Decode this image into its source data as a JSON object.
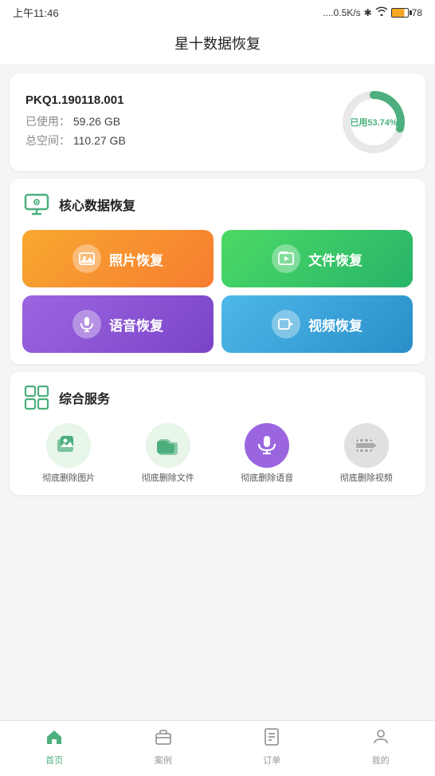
{
  "statusBar": {
    "time": "上午11:46",
    "signal": "....0.5K/s",
    "battery": "78"
  },
  "header": {
    "title": "星十数据恢复"
  },
  "storage": {
    "deviceId": "PKQ1.190118.001",
    "usedLabel": "已使用：",
    "usedValue": "59.26 GB",
    "totalLabel": "总空间：",
    "totalValue": "110.27 GB",
    "usedPercent": "已用53.74%",
    "usedPercentNum": 53.74
  },
  "coreSection": {
    "title": "核心数据恢复",
    "buttons": [
      {
        "id": "photo",
        "label": "照片恢复",
        "icon": "🖼"
      },
      {
        "id": "file",
        "label": "文件恢复",
        "icon": "▶"
      },
      {
        "id": "voice",
        "label": "语音恢复",
        "icon": "🎤"
      },
      {
        "id": "video",
        "label": "视频恢复",
        "icon": "🎬"
      }
    ]
  },
  "servicesSection": {
    "title": "综合服务",
    "items": [
      {
        "id": "del-photo",
        "label": "彻底删除图片",
        "iconType": "green-photo"
      },
      {
        "id": "del-file",
        "label": "彻底删除文件",
        "iconType": "green-file"
      },
      {
        "id": "del-voice",
        "label": "彻底删除语音",
        "iconType": "purple"
      },
      {
        "id": "del-video",
        "label": "彻底删除视频",
        "iconType": "gray"
      }
    ]
  },
  "bottomNav": [
    {
      "id": "home",
      "label": "首页",
      "icon": "home",
      "active": true
    },
    {
      "id": "case",
      "label": "案例",
      "icon": "case",
      "active": false
    },
    {
      "id": "order",
      "label": "订单",
      "icon": "order",
      "active": false
    },
    {
      "id": "mine",
      "label": "我的",
      "icon": "mine",
      "active": false
    }
  ]
}
